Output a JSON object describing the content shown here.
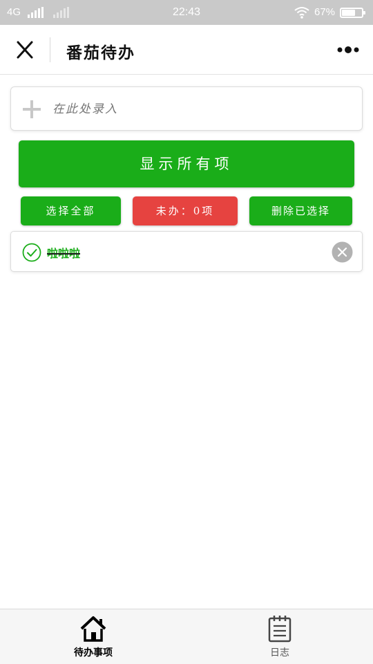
{
  "status_bar": {
    "network": "4G",
    "time": "22:43",
    "battery": "67%",
    "battery_level": 0.67
  },
  "nav": {
    "title": "番茄待办",
    "close_icon": "close-icon",
    "more_icon": "more-dots-icon"
  },
  "input": {
    "placeholder": "在此处录入",
    "value": ""
  },
  "buttons": {
    "show_all": "显示所有项",
    "select_all": "选择全部",
    "pending": "未办：0项",
    "delete_selected": "删除已选择"
  },
  "todos": [
    {
      "text": "啦啦啦",
      "done": true
    }
  ],
  "tabs": [
    {
      "label": "待办事项",
      "icon": "home-icon",
      "active": true
    },
    {
      "label": "日志",
      "icon": "notebook-icon",
      "active": false
    }
  ],
  "colors": {
    "primary_green": "#1aad19",
    "warn_red": "#e64340",
    "status_bar": "#c9c9c9"
  }
}
